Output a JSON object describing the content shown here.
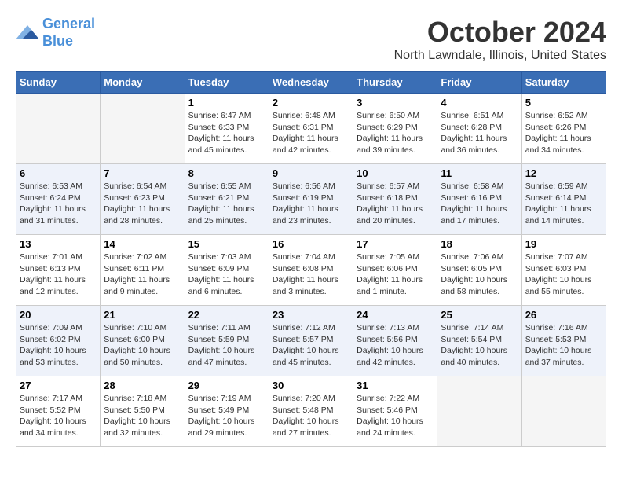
{
  "header": {
    "logo_line1": "General",
    "logo_line2": "Blue",
    "month_title": "October 2024",
    "location": "North Lawndale, Illinois, United States"
  },
  "days_of_week": [
    "Sunday",
    "Monday",
    "Tuesday",
    "Wednesday",
    "Thursday",
    "Friday",
    "Saturday"
  ],
  "weeks": [
    [
      {
        "day": "",
        "empty": true
      },
      {
        "day": "",
        "empty": true
      },
      {
        "day": "1",
        "sunrise": "6:47 AM",
        "sunset": "6:33 PM",
        "daylight": "11 hours and 45 minutes."
      },
      {
        "day": "2",
        "sunrise": "6:48 AM",
        "sunset": "6:31 PM",
        "daylight": "11 hours and 42 minutes."
      },
      {
        "day": "3",
        "sunrise": "6:50 AM",
        "sunset": "6:29 PM",
        "daylight": "11 hours and 39 minutes."
      },
      {
        "day": "4",
        "sunrise": "6:51 AM",
        "sunset": "6:28 PM",
        "daylight": "11 hours and 36 minutes."
      },
      {
        "day": "5",
        "sunrise": "6:52 AM",
        "sunset": "6:26 PM",
        "daylight": "11 hours and 34 minutes."
      }
    ],
    [
      {
        "day": "6",
        "sunrise": "6:53 AM",
        "sunset": "6:24 PM",
        "daylight": "11 hours and 31 minutes."
      },
      {
        "day": "7",
        "sunrise": "6:54 AM",
        "sunset": "6:23 PM",
        "daylight": "11 hours and 28 minutes."
      },
      {
        "day": "8",
        "sunrise": "6:55 AM",
        "sunset": "6:21 PM",
        "daylight": "11 hours and 25 minutes."
      },
      {
        "day": "9",
        "sunrise": "6:56 AM",
        "sunset": "6:19 PM",
        "daylight": "11 hours and 23 minutes."
      },
      {
        "day": "10",
        "sunrise": "6:57 AM",
        "sunset": "6:18 PM",
        "daylight": "11 hours and 20 minutes."
      },
      {
        "day": "11",
        "sunrise": "6:58 AM",
        "sunset": "6:16 PM",
        "daylight": "11 hours and 17 minutes."
      },
      {
        "day": "12",
        "sunrise": "6:59 AM",
        "sunset": "6:14 PM",
        "daylight": "11 hours and 14 minutes."
      }
    ],
    [
      {
        "day": "13",
        "sunrise": "7:01 AM",
        "sunset": "6:13 PM",
        "daylight": "11 hours and 12 minutes."
      },
      {
        "day": "14",
        "sunrise": "7:02 AM",
        "sunset": "6:11 PM",
        "daylight": "11 hours and 9 minutes."
      },
      {
        "day": "15",
        "sunrise": "7:03 AM",
        "sunset": "6:09 PM",
        "daylight": "11 hours and 6 minutes."
      },
      {
        "day": "16",
        "sunrise": "7:04 AM",
        "sunset": "6:08 PM",
        "daylight": "11 hours and 3 minutes."
      },
      {
        "day": "17",
        "sunrise": "7:05 AM",
        "sunset": "6:06 PM",
        "daylight": "11 hours and 1 minute."
      },
      {
        "day": "18",
        "sunrise": "7:06 AM",
        "sunset": "6:05 PM",
        "daylight": "10 hours and 58 minutes."
      },
      {
        "day": "19",
        "sunrise": "7:07 AM",
        "sunset": "6:03 PM",
        "daylight": "10 hours and 55 minutes."
      }
    ],
    [
      {
        "day": "20",
        "sunrise": "7:09 AM",
        "sunset": "6:02 PM",
        "daylight": "10 hours and 53 minutes."
      },
      {
        "day": "21",
        "sunrise": "7:10 AM",
        "sunset": "6:00 PM",
        "daylight": "10 hours and 50 minutes."
      },
      {
        "day": "22",
        "sunrise": "7:11 AM",
        "sunset": "5:59 PM",
        "daylight": "10 hours and 47 minutes."
      },
      {
        "day": "23",
        "sunrise": "7:12 AM",
        "sunset": "5:57 PM",
        "daylight": "10 hours and 45 minutes."
      },
      {
        "day": "24",
        "sunrise": "7:13 AM",
        "sunset": "5:56 PM",
        "daylight": "10 hours and 42 minutes."
      },
      {
        "day": "25",
        "sunrise": "7:14 AM",
        "sunset": "5:54 PM",
        "daylight": "10 hours and 40 minutes."
      },
      {
        "day": "26",
        "sunrise": "7:16 AM",
        "sunset": "5:53 PM",
        "daylight": "10 hours and 37 minutes."
      }
    ],
    [
      {
        "day": "27",
        "sunrise": "7:17 AM",
        "sunset": "5:52 PM",
        "daylight": "10 hours and 34 minutes."
      },
      {
        "day": "28",
        "sunrise": "7:18 AM",
        "sunset": "5:50 PM",
        "daylight": "10 hours and 32 minutes."
      },
      {
        "day": "29",
        "sunrise": "7:19 AM",
        "sunset": "5:49 PM",
        "daylight": "10 hours and 29 minutes."
      },
      {
        "day": "30",
        "sunrise": "7:20 AM",
        "sunset": "5:48 PM",
        "daylight": "10 hours and 27 minutes."
      },
      {
        "day": "31",
        "sunrise": "7:22 AM",
        "sunset": "5:46 PM",
        "daylight": "10 hours and 24 minutes."
      },
      {
        "day": "",
        "empty": true
      },
      {
        "day": "",
        "empty": true
      }
    ]
  ]
}
